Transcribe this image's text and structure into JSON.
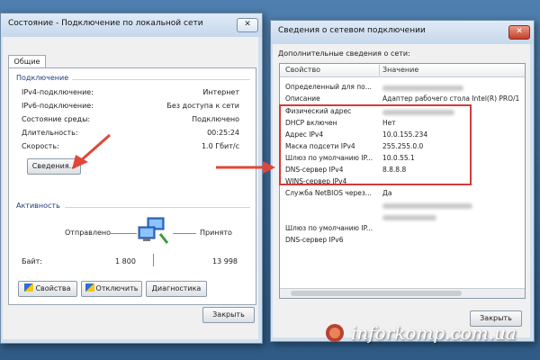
{
  "left_window": {
    "title": "Состояние - Подключение по локальной сети",
    "close": "✕",
    "tab": "Общие",
    "connection_group": "Подключение",
    "rows": [
      {
        "label": "IPv4-подключение:",
        "value": "Интернет"
      },
      {
        "label": "IPv6-подключение:",
        "value": "Без доступа к сети"
      },
      {
        "label": "Состояние среды:",
        "value": "Подключено"
      },
      {
        "label": "Длительность:",
        "value": "00:25:24"
      },
      {
        "label": "Скорость:",
        "value": "1.0 Гбит/с"
      }
    ],
    "details_button": "Сведения...",
    "activity_group": "Активность",
    "sent_label": "Отправлено",
    "received_label": "Принято",
    "bytes_label": "Байт:",
    "bytes_sent": "1 800",
    "bytes_received": "13 998",
    "properties_button": "Свойства",
    "disable_button": "Отключить",
    "diagnostics_button": "Диагностика",
    "close_button": "Закрыть"
  },
  "right_window": {
    "title": "Сведения о сетевом подключении",
    "close": "✕",
    "subtitle": "Дополнительные сведения о сети:",
    "col_property": "Свойство",
    "col_value": "Значение",
    "rows": [
      {
        "property": "Определенный для по...",
        "value": ""
      },
      {
        "property": "Описание",
        "value": "Адаптер рабочего стола Intel(R) PRO/1"
      },
      {
        "property": "Физический адрес",
        "value": ""
      },
      {
        "property": "DHCP включен",
        "value": "Нет"
      },
      {
        "property": "Адрес IPv4",
        "value": "10.0.155.234"
      },
      {
        "property": "Маска подсети IPv4",
        "value": "255.255.0.0"
      },
      {
        "property": "Шлюз по умолчанию IP...",
        "value": "10.0.55.1"
      },
      {
        "property": "DNS-сервер IPv4",
        "value": "8.8.8.8"
      },
      {
        "property": "WINS-сервер IPv4",
        "value": ""
      },
      {
        "property": "Служба NetBIOS через...",
        "value": "Да"
      },
      {
        "property": "",
        "value": ""
      },
      {
        "property": "",
        "value": ""
      },
      {
        "property": "Шлюз по умолчанию IP...",
        "value": ""
      },
      {
        "property": "DNS-сервер IPv6",
        "value": ""
      }
    ],
    "close_button": "Закрыть"
  },
  "watermark": "inforkomp.com.ua",
  "colors": {
    "highlight": "#d23b3b",
    "arrow": "#e0473a"
  }
}
